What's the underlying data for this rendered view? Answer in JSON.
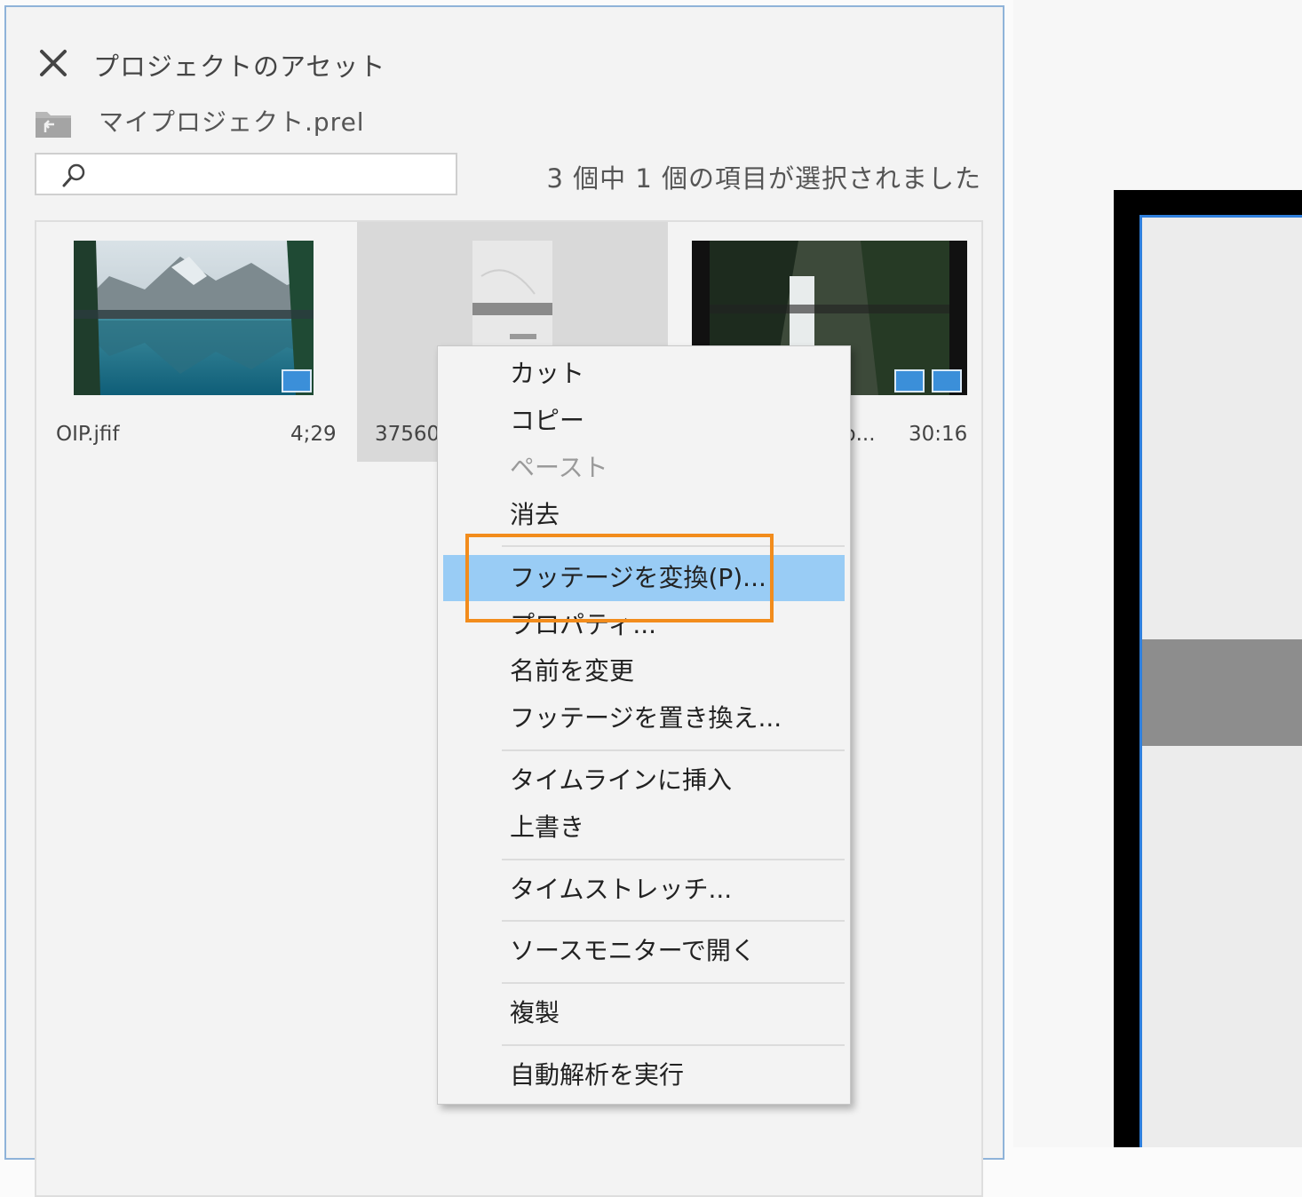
{
  "panel": {
    "title": "プロジェクトのアセット",
    "project_name": "マイプロジェクト.prel",
    "search": {
      "placeholder": "",
      "value": ""
    },
    "selection_status": "3 個中 1 個の項目が選択されました"
  },
  "assets": [
    {
      "name": "OIP.jfif",
      "duration": "4;29",
      "selected": false,
      "badges": [
        "video-icon"
      ]
    },
    {
      "name": "37560",
      "duration": "",
      "selected": true,
      "badges": []
    },
    {
      "name": "b...",
      "duration": "30:16",
      "selected": false,
      "badges": [
        "video-icon",
        "audio-icon"
      ]
    }
  ],
  "context_menu": {
    "items": [
      {
        "label": "カット",
        "state": "enabled"
      },
      {
        "label": "コピー",
        "state": "enabled"
      },
      {
        "label": "ペースト",
        "state": "disabled"
      },
      {
        "label": "消去",
        "state": "enabled"
      },
      {
        "label": "フッテージを変換(P)...",
        "state": "highlighted"
      },
      {
        "label": "プロパティ...",
        "state": "enabled"
      },
      {
        "label": "名前を変更",
        "state": "enabled"
      },
      {
        "label": "フッテージを置き換え...",
        "state": "enabled"
      },
      {
        "label": "タイムラインに挿入",
        "state": "enabled"
      },
      {
        "label": "上書き",
        "state": "enabled"
      },
      {
        "label": "タイムストレッチ...",
        "state": "enabled"
      },
      {
        "label": "ソースモニターで開く",
        "state": "enabled"
      },
      {
        "label": "複製",
        "state": "enabled"
      },
      {
        "label": "自動解析を実行",
        "state": "enabled"
      }
    ]
  },
  "colors": {
    "highlight": "#99ccf5",
    "focus_outline": "#f28c1c",
    "accent_blue": "#2f7fdc"
  }
}
